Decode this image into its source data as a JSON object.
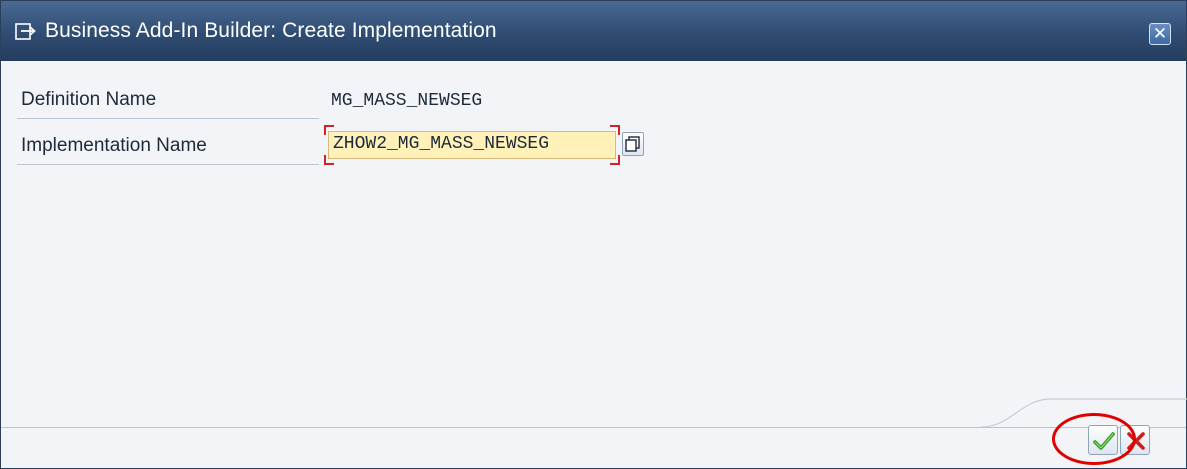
{
  "window": {
    "title": "Business Add-In Builder: Create Implementation"
  },
  "form": {
    "definition_label": "Definition Name",
    "definition_value": "MG_MASS_NEWSEG",
    "implementation_label": "Implementation Name",
    "implementation_value": "ZHOW2_MG_MASS_NEWSEG"
  },
  "icons": {
    "title_icon": "dialog-arrow-icon",
    "close": "close-icon",
    "value_help": "value-help-icon",
    "confirm": "checkmark-icon",
    "cancel": "cross-icon"
  },
  "colors": {
    "titlebar": "#2f4c72",
    "input_background": "#fff1b8",
    "required_marker": "#d22424",
    "confirm_green": "#2e9b1e",
    "cancel_red": "#d11a1a",
    "annotation_ring": "#e00000"
  }
}
